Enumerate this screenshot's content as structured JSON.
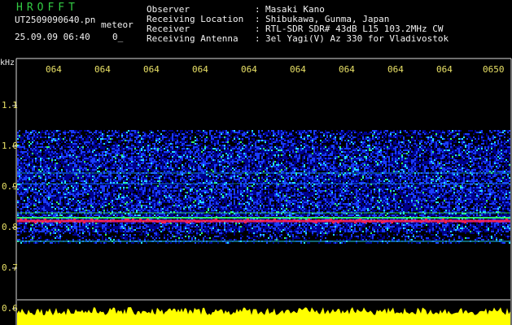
{
  "app": {
    "title": "HROFFT"
  },
  "file": {
    "name": "UT2509090640.pn",
    "suffix": "meteor"
  },
  "datetime": {
    "text": "25.09.09 06:40",
    "extra": "0_"
  },
  "info": [
    {
      "label": "Observer",
      "value": "Masaki Kano"
    },
    {
      "label": "Receiving Location",
      "value": "Shibukawa, Gunma, Japan"
    },
    {
      "label": "Receiver",
      "value": "RTL-SDR SDR# 43dB L15 103.2MHz CW"
    },
    {
      "label": "Receiving Antenna",
      "value": "3el Yagi(V) Az 330 for Vladivostok"
    }
  ],
  "separator": ":",
  "spectrogram": {
    "unit": "kHz",
    "time_ticks": [
      "064",
      "064",
      "064",
      "064",
      "064",
      "064",
      "064",
      "064",
      "064",
      "0650"
    ],
    "freq_labels": [
      "1.1",
      "1.0",
      "0.9",
      "0.8",
      "0.7",
      "0.6"
    ],
    "colors": {
      "background": "#000000",
      "noise_dark": "#00008c",
      "noise_blue": "#1a3cff",
      "cyan": "#22e0ff",
      "green": "#33ff66",
      "red": "#ff2255",
      "grid": "#dddddd",
      "labels": "#e8e066",
      "meter": "#ffff00"
    }
  }
}
